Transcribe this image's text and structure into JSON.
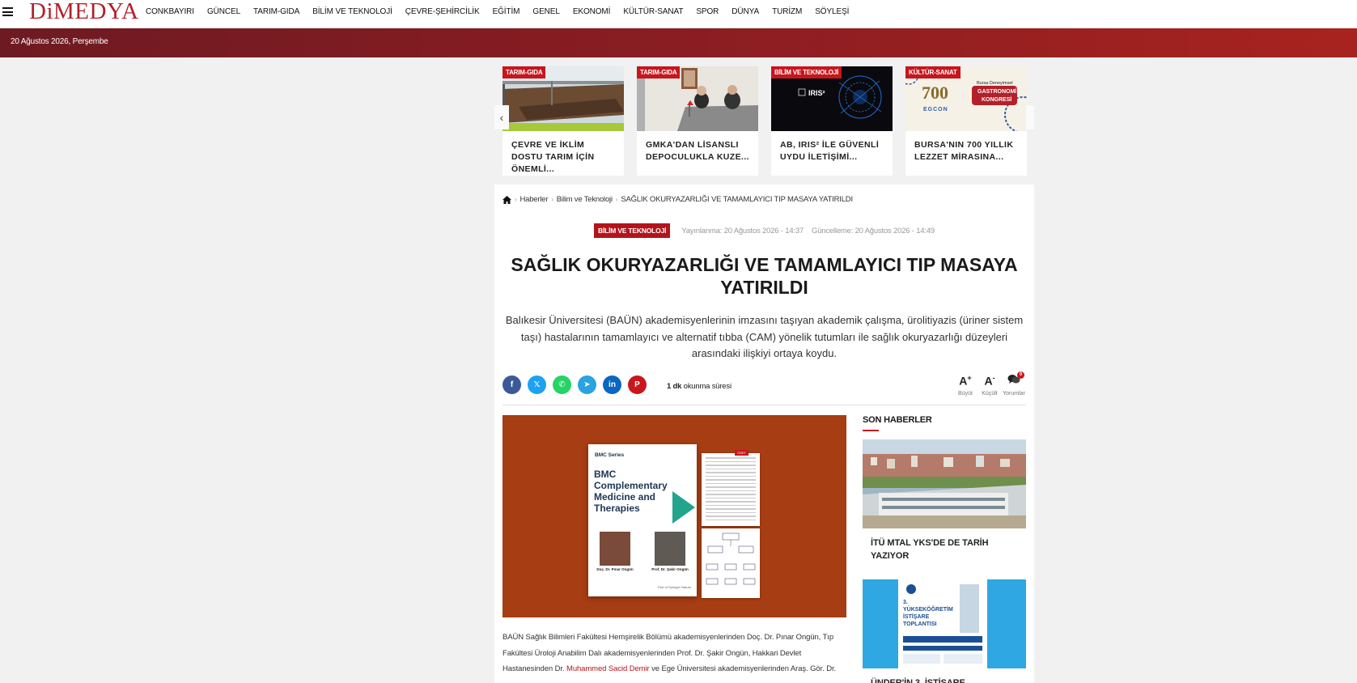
{
  "site": {
    "logo": "DiMEDYA"
  },
  "nav": [
    "CONKBAYIRI",
    "GÜNCEL",
    "TARIM-GIDA",
    "BİLİM VE TEKNOLOJİ",
    "ÇEVRE-ŞEHİRCİLİK",
    "EĞİTİM",
    "GENEL",
    "EKONOMİ",
    "KÜLTÜR-SANAT",
    "SPOR",
    "DÜNYA",
    "TURİZM",
    "SÖYLEŞİ"
  ],
  "datebar": {
    "date": "20 Ağustos 2026, Perşembe"
  },
  "slider": [
    {
      "category": "TARIM-GIDA",
      "title": "ÇEVRE VE İKLİM DOSTU TARIM İÇİN ÖNEMLİ..."
    },
    {
      "category": "TARIM-GIDA",
      "title": "GMKA'DAN LİSANSLI DEPOCULUKLA KUZE..."
    },
    {
      "category": "BİLİM VE TEKNOLOJİ",
      "title": "AB, IRIS² İLE GÜVENLİ UYDU İLETİŞİMİ..."
    },
    {
      "category": "KÜLTÜR-SANAT",
      "title": "BURSA'NIN 700 YILLIK LEZZET MİRASINA..."
    }
  ],
  "slide_images": {
    "iris_label": "IRIS²",
    "egcon_line1": "Bursa Deneyimsel",
    "egcon_line2": "GASTRONOMİ",
    "egcon_line3": "KONGRESİ",
    "egcon_year": "700",
    "egcon_brand": "EGCON"
  },
  "breadcrumb": {
    "items": [
      "Haberler",
      "Bilim ve Teknoloji",
      "SAĞLIK OKURYAZARLIĞI VE TAMAMLAYICI TIP MASAYA YATIRILDI"
    ]
  },
  "article": {
    "category": "BİLİM VE TEKNOLOJİ",
    "published": "Yayınlanma: 20 Ağustos 2026 - 14:37",
    "updated": "Güncelleme: 20 Ağustos 2026 - 14:49",
    "title": "SAĞLIK OKURYAZARLIĞI VE TAMAMLAYICI TIP MASAYA YATIRILDI",
    "lead": "Balıkesir Üniversitesi (BAÜN) akademisyenlerinin imzasını taşıyan akademik çalışma, ürolitiyazis (üriner sistem taşı) hastalarının tamamlayıcı ve alternatif tıbba (CAM) yönelik tutumları ile sağlık okuryazarlığı düzeyleri arasındaki ilişkiyi ortaya koydu.",
    "read_time_value": "1 dk",
    "read_time_label": "okunma süresi",
    "body_part1": "BAÜN Sağlık Bilimleri Fakültesi Hemşirelik Bölümü akademisyenlerinden Doç. Dr. Pınar Ongün, Tıp Fakültesi Üroloji Anabilim Dalı akademisyenlerinden Prof. Dr. Şakir Ongün, Hakkari Devlet Hastanesinden Dr. ",
    "body_link": "Muhammed Sacid Demir",
    "body_part2": " ve Ege Üniversitesi akademisyenlerinden Araş. Gör. Dr."
  },
  "share": [
    {
      "name": "facebook",
      "glyph": "f",
      "color": "#3b5998"
    },
    {
      "name": "x",
      "glyph": "𝕏",
      "color": "#1da1f2"
    },
    {
      "name": "whatsapp",
      "glyph": "✆",
      "color": "#25d366"
    },
    {
      "name": "telegram",
      "glyph": "➤",
      "color": "#2aa3df"
    },
    {
      "name": "linkedin",
      "glyph": "in",
      "color": "#0a66c2"
    },
    {
      "name": "pinterest",
      "glyph": "P",
      "color": "#c8161d"
    }
  ],
  "tools": {
    "bigger": "Büyüt",
    "smaller": "Küçült",
    "comments": "Yorumlar",
    "comment_count": "0",
    "font_glyph": "A"
  },
  "image_cover": {
    "series": "BMC Series",
    "journal": "BMC Complementary Medicine and Therapies",
    "person1": "Doç. Dr. Pınar Ongün",
    "person2": "Prof. Dr. Şakir Ongün",
    "footer": "Part of Springer Nature",
    "page_tag": "ÖZET"
  },
  "sidebar": {
    "title": "SON HABERLER",
    "items": [
      {
        "title": "İTÜ MTAL YKS'DE DE TARİH YAZIYOR"
      },
      {
        "title": "ÜNDER'İN 3. İSTİŞARE"
      }
    ],
    "poster_title": "3. YÜKSEKÖĞRETİM İSTİŞARE TOPLANTISI"
  }
}
